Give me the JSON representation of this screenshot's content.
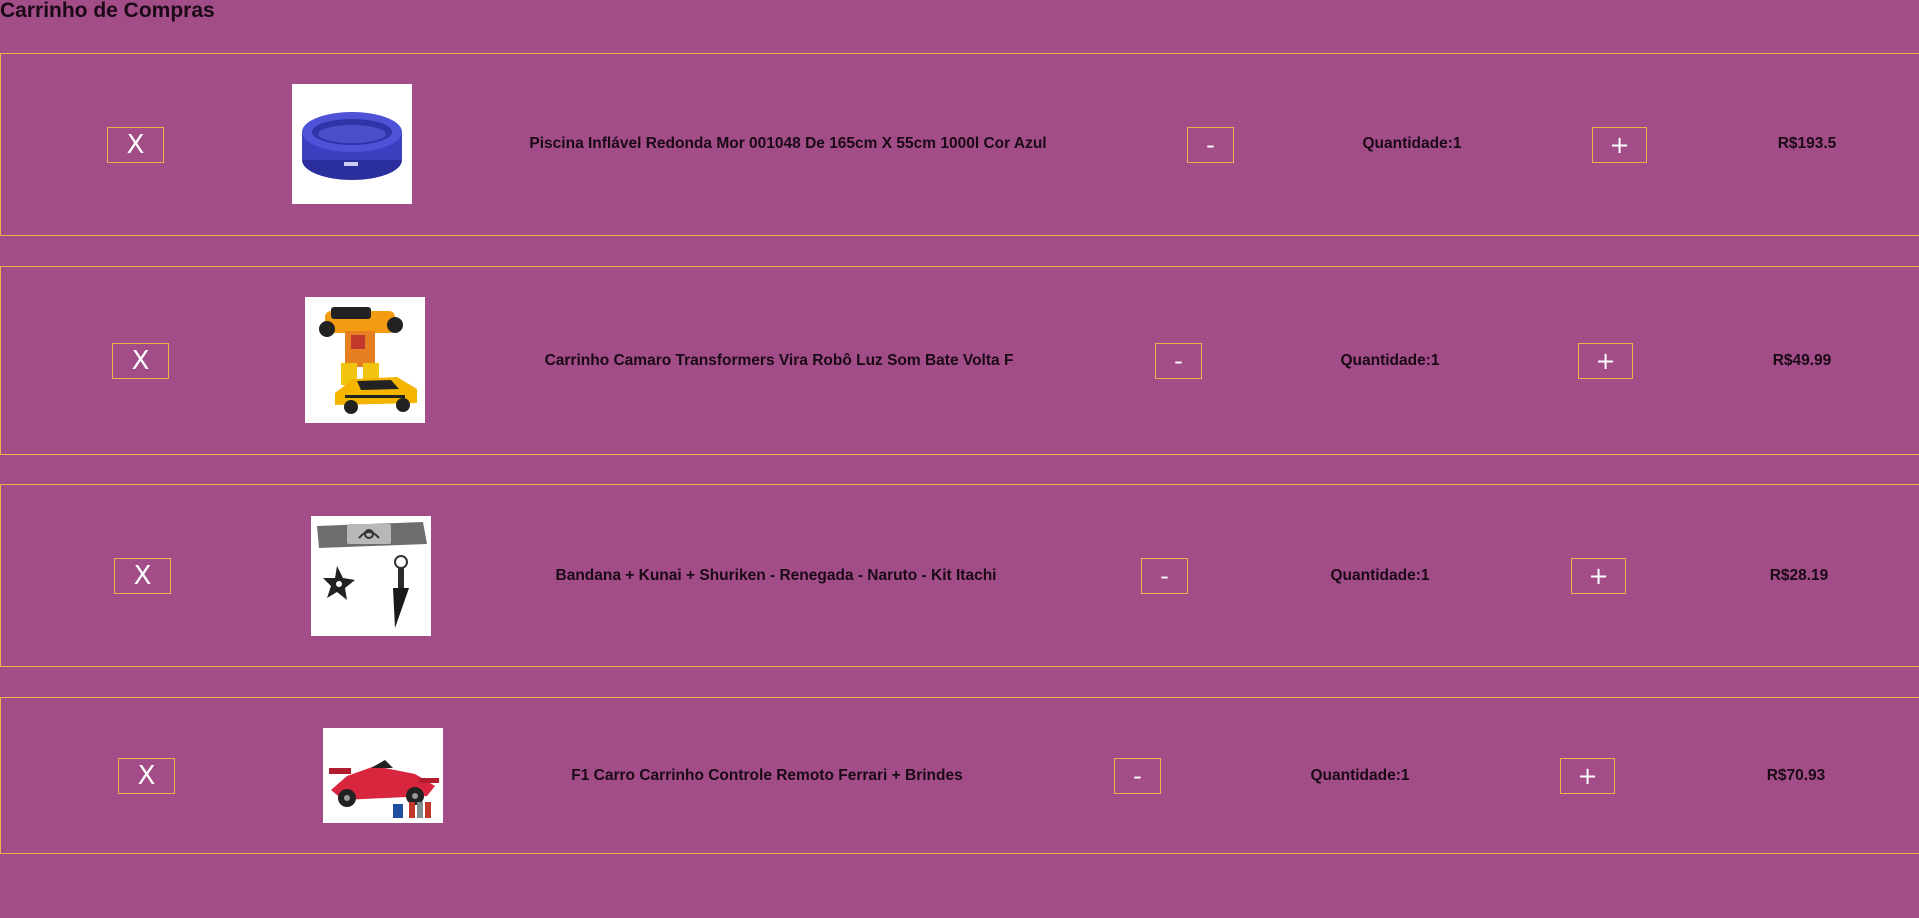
{
  "cart": {
    "title": "Carrinho de Compras",
    "quantity_label": "Quantidade:",
    "remove_label": "X",
    "decrease_label": "-",
    "increase_label": "+",
    "currency": "R$",
    "items": [
      {
        "name": "Piscina Inflável Redonda Mor 001048 De 165cm X 55cm 1000l Cor Azul",
        "quantity": 1,
        "price": "193.5",
        "quantity_text": "Quantidade:1",
        "price_text": "R$193.5",
        "image_icon": "inflatable-pool-image"
      },
      {
        "name": "Carrinho Camaro Transformers Vira Robô Luz Som Bate Volta F",
        "quantity": 1,
        "price": "49.99",
        "quantity_text": "Quantidade:1",
        "price_text": "R$49.99",
        "image_icon": "transformer-car-image"
      },
      {
        "name": "Bandana + Kunai + Shuriken - Renegada - Naruto - Kit Itachi",
        "quantity": 1,
        "price": "28.19",
        "quantity_text": "Quantidade:1",
        "price_text": "R$28.19",
        "image_icon": "naruto-kit-image"
      },
      {
        "name": "F1 Carro Carrinho Controle Remoto Ferrari + Brindes",
        "quantity": 1,
        "price": "70.93",
        "quantity_text": "Quantidade:1",
        "price_text": "R$70.93",
        "image_icon": "f1-ferrari-car-image"
      }
    ]
  },
  "colors": {
    "background": "#a24c88",
    "border": "#e8b34a",
    "text": "#1a0a16",
    "button_text": "#ffffff"
  }
}
